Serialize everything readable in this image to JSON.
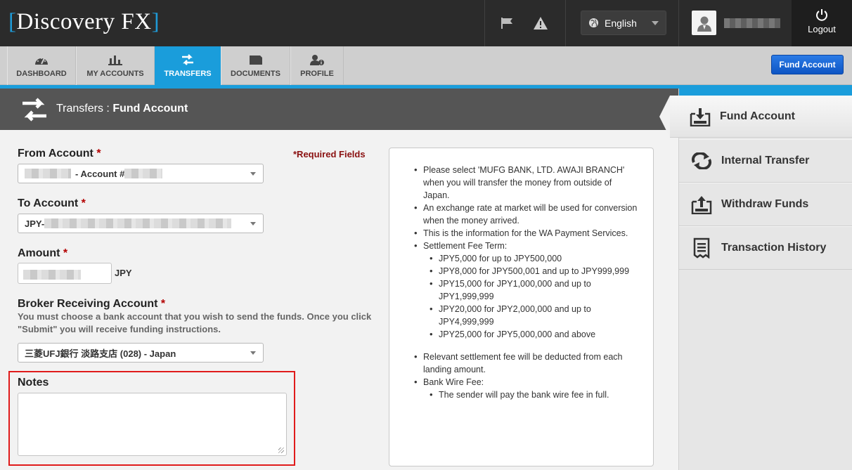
{
  "header": {
    "logo_text": "Discovery FX",
    "language": "English",
    "logout_label": "Logout"
  },
  "nav": {
    "tabs": [
      {
        "label": "DASHBOARD",
        "icon": "gauge-icon"
      },
      {
        "label": "MY ACCOUNTS",
        "icon": "bar-chart-icon"
      },
      {
        "label": "TRANSFERS",
        "icon": "transfer-arrows-icon",
        "active": true
      },
      {
        "label": "DOCUMENTS",
        "icon": "folder-icon"
      },
      {
        "label": "PROFILE",
        "icon": "user-info-icon"
      }
    ],
    "fund_account_button": "Fund Account"
  },
  "title": {
    "section": "Transfers",
    "separator": " : ",
    "page": "Fund Account"
  },
  "form": {
    "required_note": "*Required Fields",
    "from_account": {
      "label": "From Account",
      "value_suffix": "- Account #"
    },
    "to_account": {
      "label": "To Account",
      "value_prefix": "JPY-"
    },
    "amount": {
      "label": "Amount",
      "currency": "JPY"
    },
    "broker": {
      "label": "Broker Receiving Account",
      "help": "You must choose a bank account that you wish to send the funds. Once you click \"Submit\" you will receive funding instructions.",
      "value": "三菱UFJ銀行 淡路支店 (028) - Japan"
    },
    "notes": {
      "label": "Notes"
    },
    "required_mark": "*"
  },
  "info": {
    "items": [
      "Please select 'MUFG BANK, LTD. AWAJI BRANCH' when you will transfer the money from outside of Japan.",
      "An exchange rate at market will be used for conversion when the money arrived.",
      "This is the information for the WA Payment Services."
    ],
    "settlement_fee_term": "Settlement Fee Term:",
    "fees": [
      "JPY5,000 for up to JPY500,000",
      "JPY8,000 for JPY500,001 and up to JPY999,999",
      "JPY15,000 for JPY1,000,000 and up to JPY1,999,999",
      "JPY20,000 for JPY2,000,000 and up to JPY4,999,999",
      "JPY25,000 for JPY5,000,000 and above"
    ],
    "deduct_note": "Relevant settlement fee will be deducted from each landing amount.",
    "bank_wire_fee": "Bank Wire Fee:",
    "wire_note": "The sender will pay the bank wire fee in full."
  },
  "sidebar": {
    "items": [
      {
        "label": "Fund Account",
        "icon": "fund-account-icon",
        "active": true
      },
      {
        "label": "Internal Transfer",
        "icon": "internal-transfer-icon"
      },
      {
        "label": "Withdraw Funds",
        "icon": "withdraw-funds-icon"
      },
      {
        "label": "Transaction History",
        "icon": "transaction-history-icon"
      }
    ]
  },
  "colors": {
    "accent": "#1a9ddb",
    "header_bg": "#2b2b2b",
    "button_blue": "#0d55c4",
    "required_red": "#b30000",
    "highlight_border": "#e01b1b"
  }
}
